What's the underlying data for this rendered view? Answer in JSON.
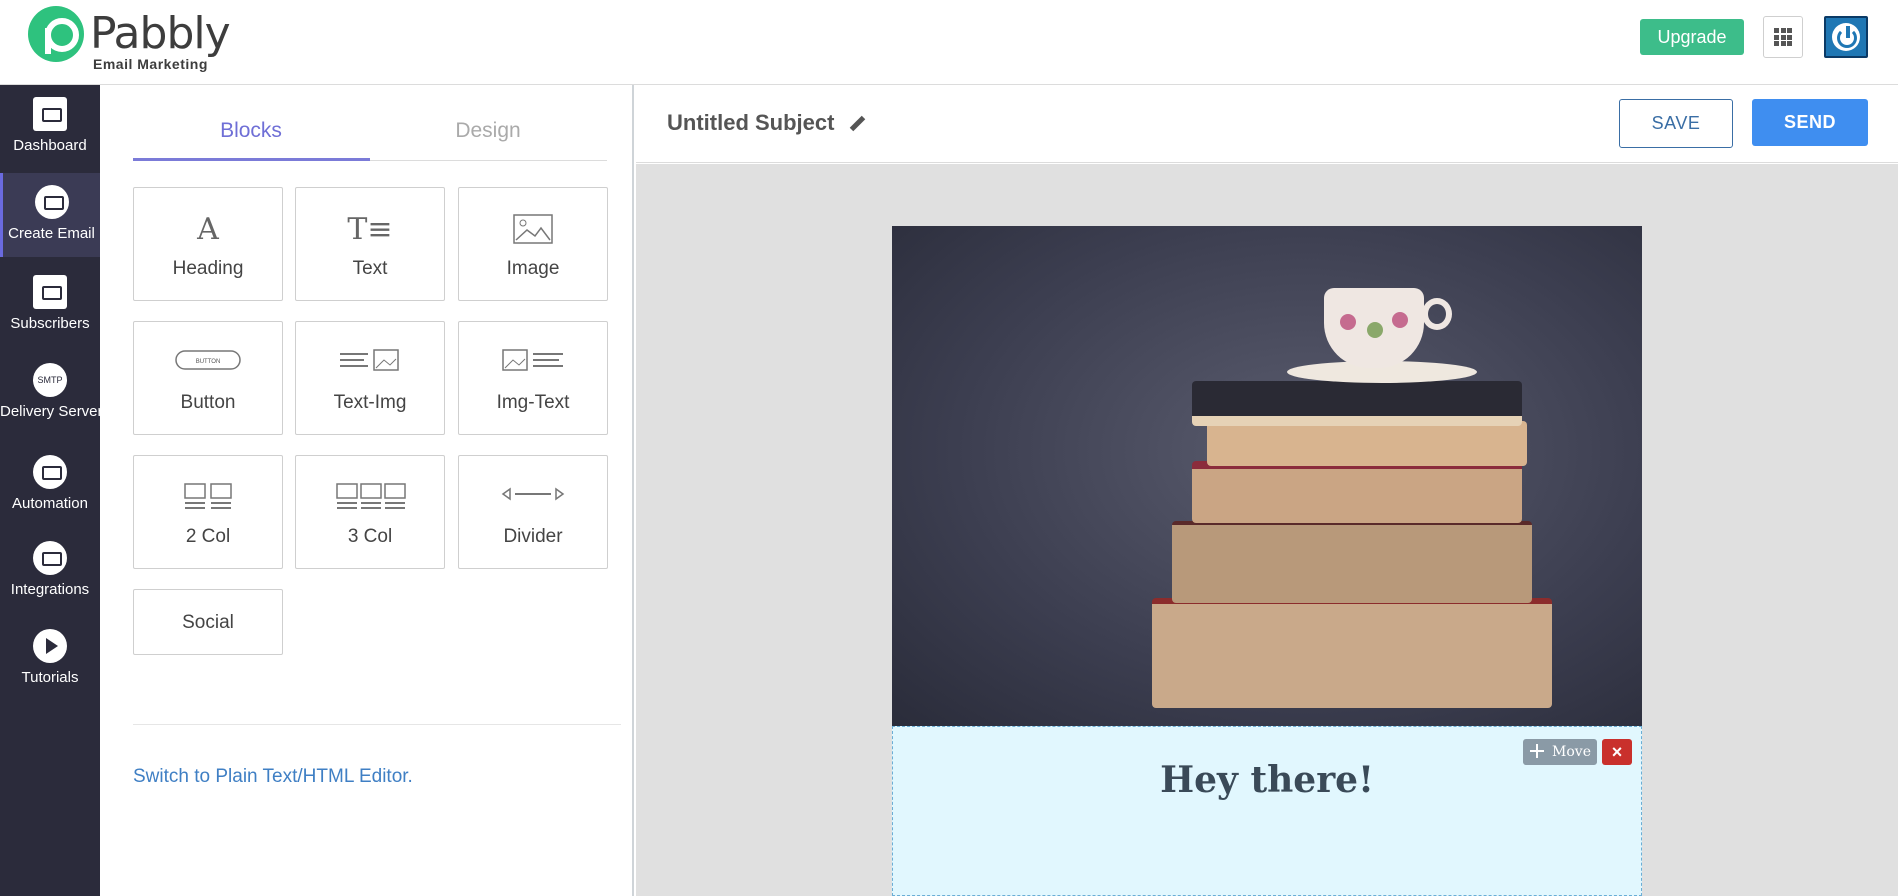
{
  "brand": {
    "name": "Pabbly",
    "subtitle": "Email Marketing",
    "accent_color": "#2ec27e"
  },
  "header": {
    "upgrade_label": "Upgrade",
    "apps_icon": "grid-icon",
    "power_icon": "power-icon"
  },
  "sidebar": {
    "items": [
      {
        "label": "Dashboard",
        "icon": "dashboard-icon"
      },
      {
        "label": "Create Email",
        "icon": "envelope-icon"
      },
      {
        "label": "Subscribers",
        "icon": "address-book-icon"
      },
      {
        "label": "Delivery Server",
        "icon": "smtp-icon",
        "icon_text": "SMTP"
      },
      {
        "label": "Automation",
        "icon": "gear-icon"
      },
      {
        "label": "Integrations",
        "icon": "webhook-icon"
      },
      {
        "label": "Tutorials",
        "icon": "play-icon"
      }
    ],
    "active_index": 1
  },
  "panel": {
    "tabs": [
      {
        "label": "Blocks",
        "active": true
      },
      {
        "label": "Design",
        "active": false
      }
    ],
    "blocks": [
      {
        "label": "Heading",
        "icon": "heading-icon"
      },
      {
        "label": "Text",
        "icon": "text-icon"
      },
      {
        "label": "Image",
        "icon": "image-icon"
      },
      {
        "label": "Button",
        "icon": "button-icon",
        "icon_text": "BUTTON"
      },
      {
        "label": "Text-Img",
        "icon": "text-img-icon"
      },
      {
        "label": "Img-Text",
        "icon": "img-text-icon"
      },
      {
        "label": "2 Col",
        "icon": "two-column-icon"
      },
      {
        "label": "3 Col",
        "icon": "three-column-icon"
      },
      {
        "label": "Divider",
        "icon": "divider-icon"
      },
      {
        "label": "Social",
        "icon": ""
      }
    ],
    "switch_link": "Switch to Plain Text/HTML Editor."
  },
  "editor": {
    "subject": "Untitled Subject",
    "save_label": "SAVE",
    "send_label": "SEND",
    "heading_text": "Hey there!",
    "move_label": "Move",
    "close_label": "×"
  }
}
